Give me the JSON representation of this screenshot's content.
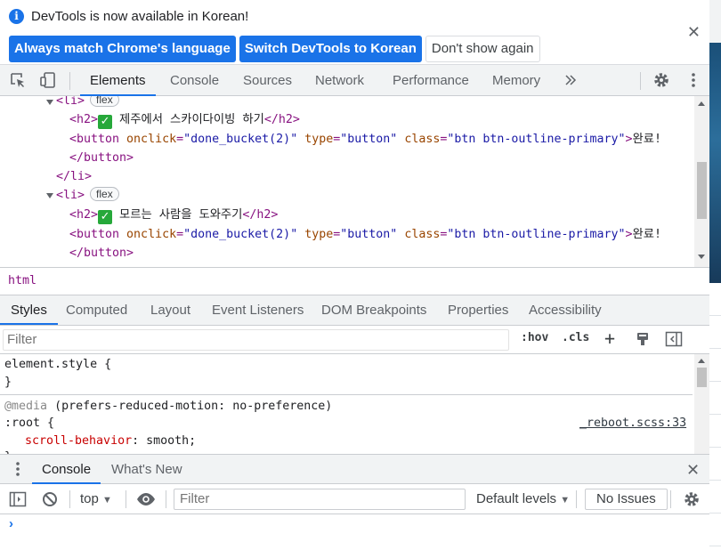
{
  "infobar": {
    "message": "DevTools is now available in Korean!",
    "buttons": [
      "Always match Chrome's language",
      "Switch DevTools to Korean",
      "Don't show again"
    ]
  },
  "main_tabs": [
    "Elements",
    "Console",
    "Sources",
    "Network",
    "Performance",
    "Memory"
  ],
  "active_main_tab": "Elements",
  "dom": {
    "badge": "flex",
    "items": [
      {
        "title": "제주에서 스카이다이빙 하기",
        "onclick": "\"done_bucket(2)\"",
        "type": "\"button\"",
        "class": "\"btn btn-outline-primary\"",
        "button_text": "완료!"
      },
      {
        "title": "모르는 사람을 도와주기",
        "onclick": "\"done_bucket(2)\"",
        "type": "\"button\"",
        "class": "\"btn btn-outline-primary\"",
        "button_text": "완료!"
      }
    ],
    "check_glyph": "✓"
  },
  "breadcrumb": "html",
  "sub_tabs": [
    "Styles",
    "Computed",
    "Layout",
    "Event Listeners",
    "DOM Breakpoints",
    "Properties",
    "Accessibility"
  ],
  "active_sub_tab": "Styles",
  "styles": {
    "filter_placeholder": "Filter",
    "hov": ":hov",
    "cls": ".cls",
    "element_style": "element.style {",
    "close_brace": "}",
    "media_keyword": "@media",
    "media_query": "(prefers-reduced-motion: no-preference)",
    "selector": ":root {",
    "source": "_reboot.scss:33",
    "property": "scroll-behavior",
    "value": "smooth"
  },
  "drawer": {
    "tabs": [
      "Console",
      "What's New"
    ],
    "active_tab": "Console",
    "context": "top",
    "filter_placeholder": "Filter",
    "levels": "Default levels",
    "issues": "No Issues",
    "prompt": "›"
  },
  "colors": {
    "accent": "#1a73e8",
    "tag": "#881280",
    "attr_name": "#994500",
    "attr_value": "#1a1aa6",
    "css_property": "#c80000"
  }
}
